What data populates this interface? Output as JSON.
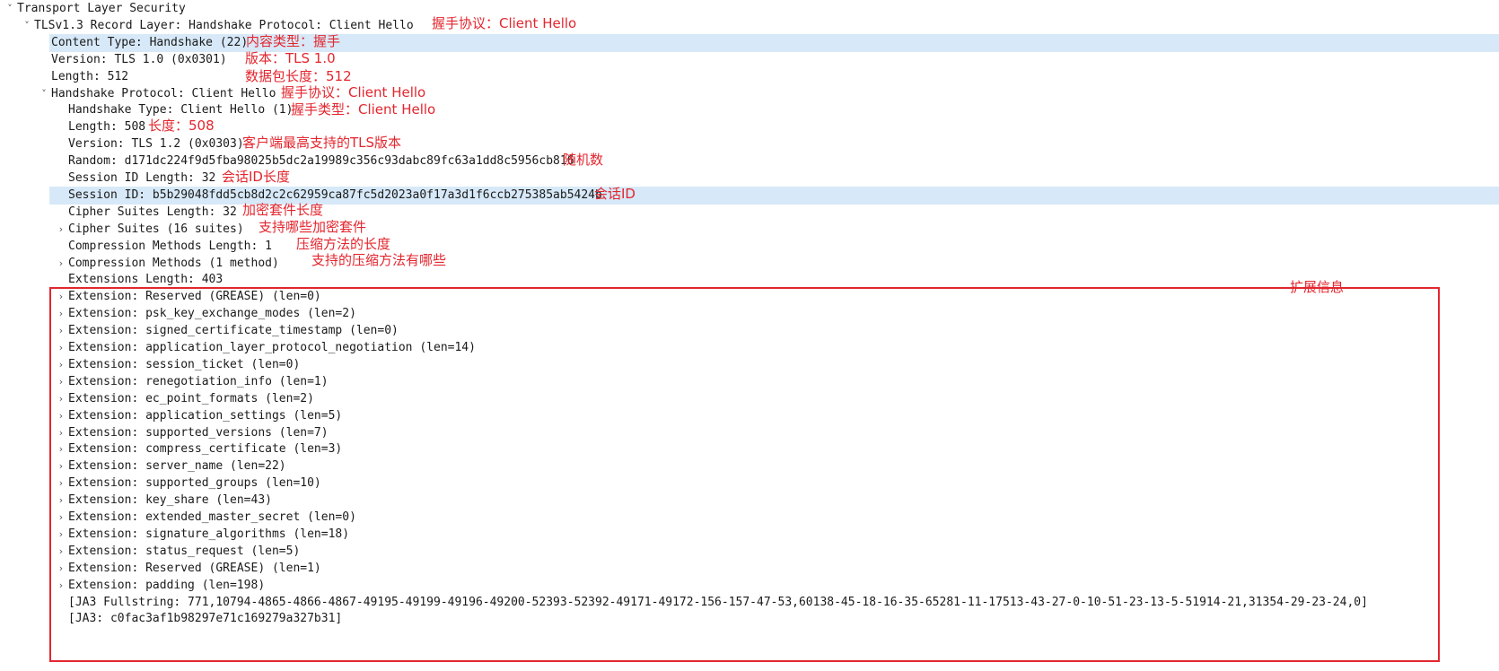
{
  "colors": {
    "annotation": "#e3262e",
    "highlight_row": "#d7e9f8",
    "tree_text": "#1a1a1a"
  },
  "tree": {
    "rows": [
      {
        "label": "Transport Layer Security",
        "toggle": "expanded"
      },
      {
        "label": "TLSv1.3 Record Layer: Handshake Protocol: Client Hello",
        "toggle": "expanded"
      },
      {
        "label": "Content Type: Handshake (22)",
        "toggle": "none"
      },
      {
        "label": "Version: TLS 1.0 (0x0301)",
        "toggle": "none"
      },
      {
        "label": "Length: 512",
        "toggle": "none"
      },
      {
        "label": "Handshake Protocol: Client Hello",
        "toggle": "expanded"
      },
      {
        "label": "Handshake Type: Client Hello (1)",
        "toggle": "none"
      },
      {
        "label": "Length: 508",
        "toggle": "none"
      },
      {
        "label": "Version: TLS 1.2 (0x0303)",
        "toggle": "none"
      },
      {
        "label": "Random: d171dc224f9d5fba98025b5dc2a19989c356c93dabc89fc63a1dd8c5956cb816",
        "toggle": "none"
      },
      {
        "label": "Session ID Length: 32",
        "toggle": "none"
      },
      {
        "label": "Session ID: b5b29048fdd5cb8d2c2c62959ca87fc5d2023a0f17a3d1f6ccb275385ab5424b",
        "toggle": "none"
      },
      {
        "label": "Cipher Suites Length: 32",
        "toggle": "none"
      },
      {
        "label": "Cipher Suites (16 suites)",
        "toggle": "collapsed"
      },
      {
        "label": "Compression Methods Length: 1",
        "toggle": "none"
      },
      {
        "label": "Compression Methods (1 method)",
        "toggle": "collapsed"
      },
      {
        "label": "Extensions Length: 403",
        "toggle": "none"
      },
      {
        "label": "Extension: Reserved (GREASE) (len=0)",
        "toggle": "collapsed"
      },
      {
        "label": "Extension: psk_key_exchange_modes (len=2)",
        "toggle": "collapsed"
      },
      {
        "label": "Extension: signed_certificate_timestamp (len=0)",
        "toggle": "collapsed"
      },
      {
        "label": "Extension: application_layer_protocol_negotiation (len=14)",
        "toggle": "collapsed"
      },
      {
        "label": "Extension: session_ticket (len=0)",
        "toggle": "collapsed"
      },
      {
        "label": "Extension: renegotiation_info (len=1)",
        "toggle": "collapsed"
      },
      {
        "label": "Extension: ec_point_formats (len=2)",
        "toggle": "collapsed"
      },
      {
        "label": "Extension: application_settings (len=5)",
        "toggle": "collapsed"
      },
      {
        "label": "Extension: supported_versions (len=7)",
        "toggle": "collapsed"
      },
      {
        "label": "Extension: compress_certificate (len=3)",
        "toggle": "collapsed"
      },
      {
        "label": "Extension: server_name (len=22)",
        "toggle": "collapsed"
      },
      {
        "label": "Extension: supported_groups (len=10)",
        "toggle": "collapsed"
      },
      {
        "label": "Extension: key_share (len=43)",
        "toggle": "collapsed"
      },
      {
        "label": "Extension: extended_master_secret (len=0)",
        "toggle": "collapsed"
      },
      {
        "label": "Extension: signature_algorithms (len=18)",
        "toggle": "collapsed"
      },
      {
        "label": "Extension: status_request (len=5)",
        "toggle": "collapsed"
      },
      {
        "label": "Extension: Reserved (GREASE) (len=1)",
        "toggle": "collapsed"
      },
      {
        "label": "Extension: padding (len=198)",
        "toggle": "collapsed"
      },
      {
        "label": "[JA3 Fullstring: 771,10794-4865-4866-4867-49195-49199-49196-49200-52393-52392-49171-49172-156-157-47-53,60138-45-18-16-35-65281-11-17513-43-27-0-10-51-23-13-5-51914-21,31354-29-23-24,0]",
        "toggle": "none"
      },
      {
        "label": "[JA3: c0fac3af1b98297e71c169279a327b31]",
        "toggle": "none"
      }
    ]
  },
  "annotations": {
    "record_layer": "握手协议：Client Hello",
    "content_type": "内容类型：握手",
    "version": "版本：TLS 1.0",
    "length": "数据包长度：512",
    "handshake_protocol": "握手协议：Client Hello",
    "handshake_type": "握手类型：Client Hello",
    "hs_length": "长度：508",
    "hs_version": "客户端最高支持的TLS版本",
    "random": "随机数",
    "session_id_length": "会话ID长度",
    "session_id": "会话ID",
    "cipher_suites_length": "加密套件长度",
    "cipher_suites": "支持哪些加密套件",
    "compression_methods_length": "压缩方法的长度",
    "compression_methods": "支持的压缩方法有哪些",
    "extensions": "扩展信息"
  }
}
